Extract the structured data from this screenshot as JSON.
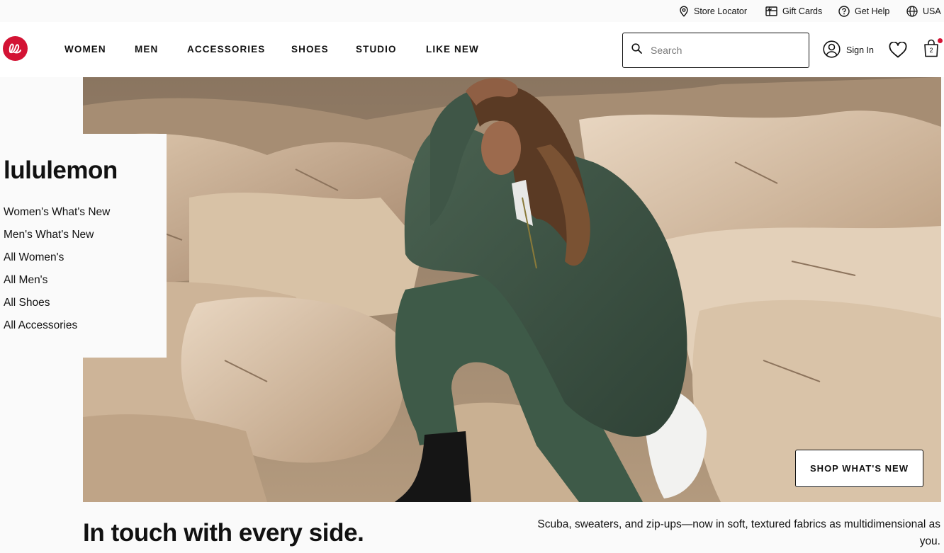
{
  "utility": {
    "store_locator": "Store Locator",
    "gift_cards": "Gift Cards",
    "get_help": "Get Help",
    "region": "USA"
  },
  "nav": {
    "links": [
      "WOMEN",
      "MEN",
      "ACCESSORIES",
      "SHOES",
      "STUDIO",
      "LIKE NEW"
    ]
  },
  "search": {
    "placeholder": "Search"
  },
  "account": {
    "sign_in": "Sign In"
  },
  "bag": {
    "count": "2"
  },
  "side": {
    "title": "lululemon",
    "links": [
      "Women's What's New",
      "Men's What's New",
      "All Women's",
      "All Men's",
      "All Shoes",
      "All Accessories"
    ]
  },
  "hero": {
    "cta": "SHOP WHAT'S NEW",
    "headline": "In touch with every side.",
    "subcopy": "Scuba, sweaters, and zip-ups—now in soft, textured fabrics as multidimensional as you."
  },
  "colors": {
    "brand_red": "#d31334",
    "text": "#111111",
    "background": "#fafafa"
  }
}
